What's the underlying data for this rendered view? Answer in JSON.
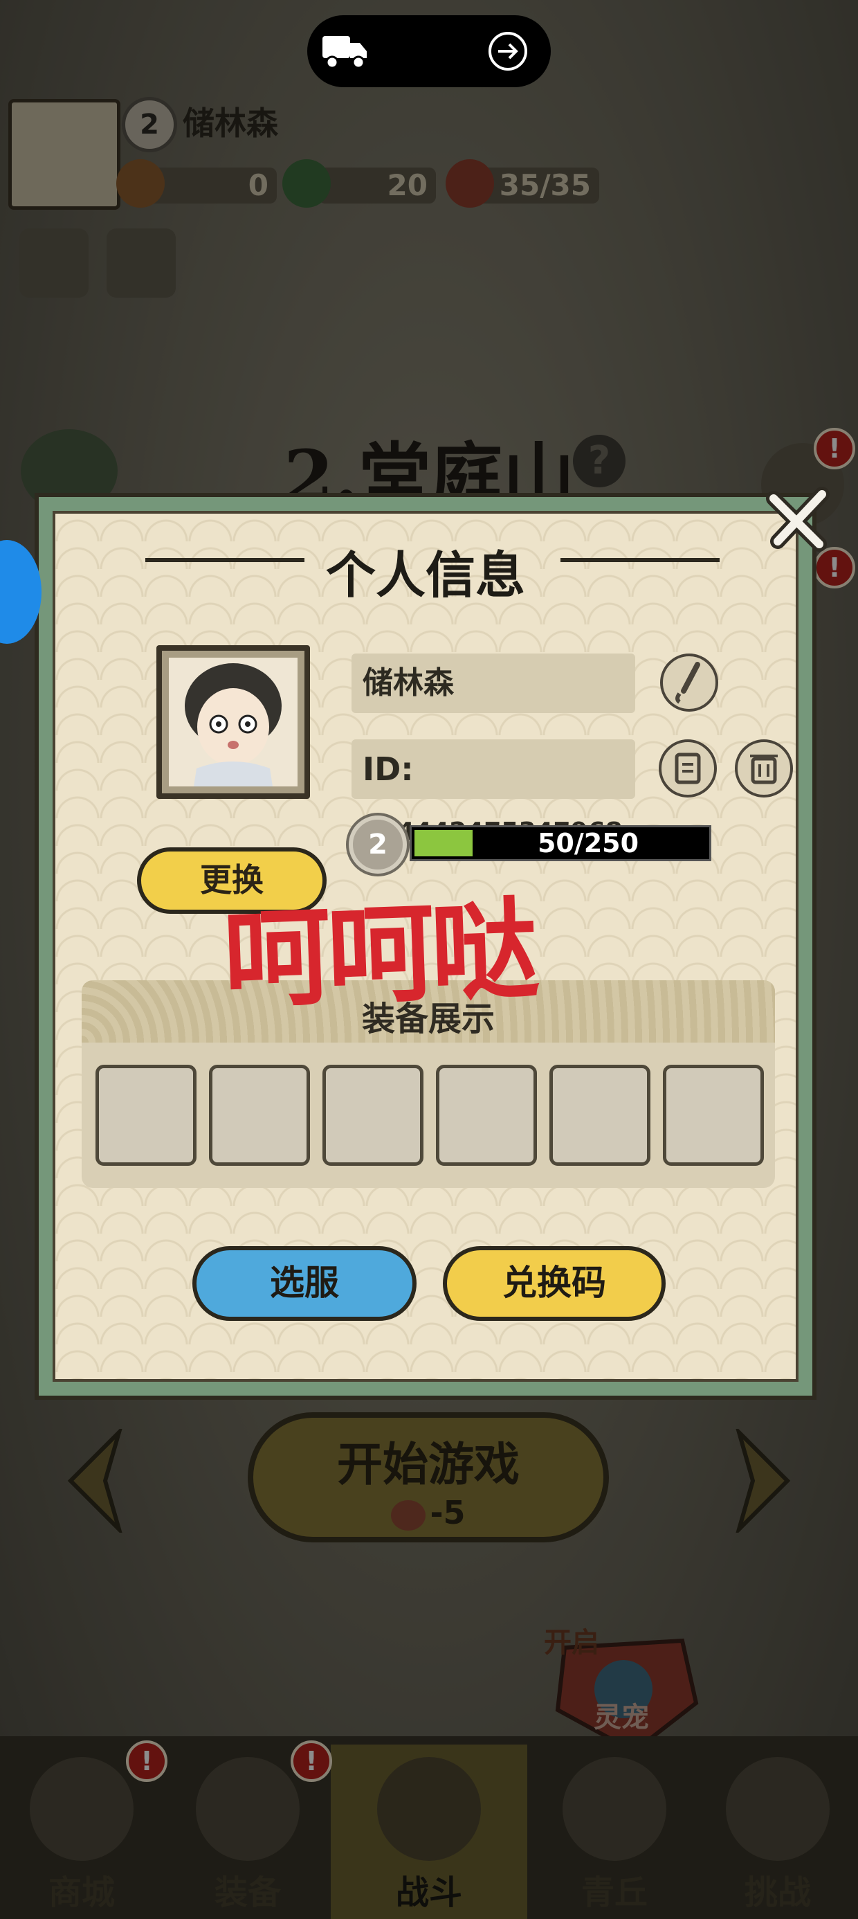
{
  "hud": {
    "player_name": "储林森",
    "level": "2",
    "currency_gold": "0",
    "currency_jade": "20",
    "stamina": "35/35"
  },
  "stage": {
    "title": "2.堂庭山",
    "help_glyph": "?"
  },
  "start": {
    "label": "开始游戏",
    "cost": "-5"
  },
  "pet_badge": {
    "top_label": "开启",
    "label": "灵宠"
  },
  "tabs": [
    {
      "label": "商城"
    },
    {
      "label": "装备"
    },
    {
      "label": "战斗"
    },
    {
      "label": "青丘"
    },
    {
      "label": "挑战"
    }
  ],
  "alert_glyph": "!",
  "dialog": {
    "title": "个人信息",
    "name": "储林森",
    "id_prefix": "ID:",
    "id_value": "514442475347968",
    "level": "2",
    "xp_text": "50/250",
    "xp_progress": 0.2,
    "change_button": "更换",
    "stamp_text": "呵呵哒",
    "equip_title": "装备展示",
    "equip_slot_count": 6,
    "select_server_button": "选服",
    "redeem_button": "兑换码"
  },
  "colors": {
    "dialog_frame": "#75977a",
    "paper": "#ede3ca",
    "stamp_red": "#d7262d",
    "blue_button": "#4fa9dc",
    "yellow_button": "#f2cd4b",
    "xp_green": "#8cc63f"
  },
  "icons": [
    "truck-icon",
    "exit-icon",
    "close-icon",
    "edit-brush-icon",
    "copy-icon",
    "delete-icon",
    "settings-gear-icon",
    "card-icon",
    "arrow-left-icon",
    "arrow-right-icon",
    "peach-icon"
  ]
}
